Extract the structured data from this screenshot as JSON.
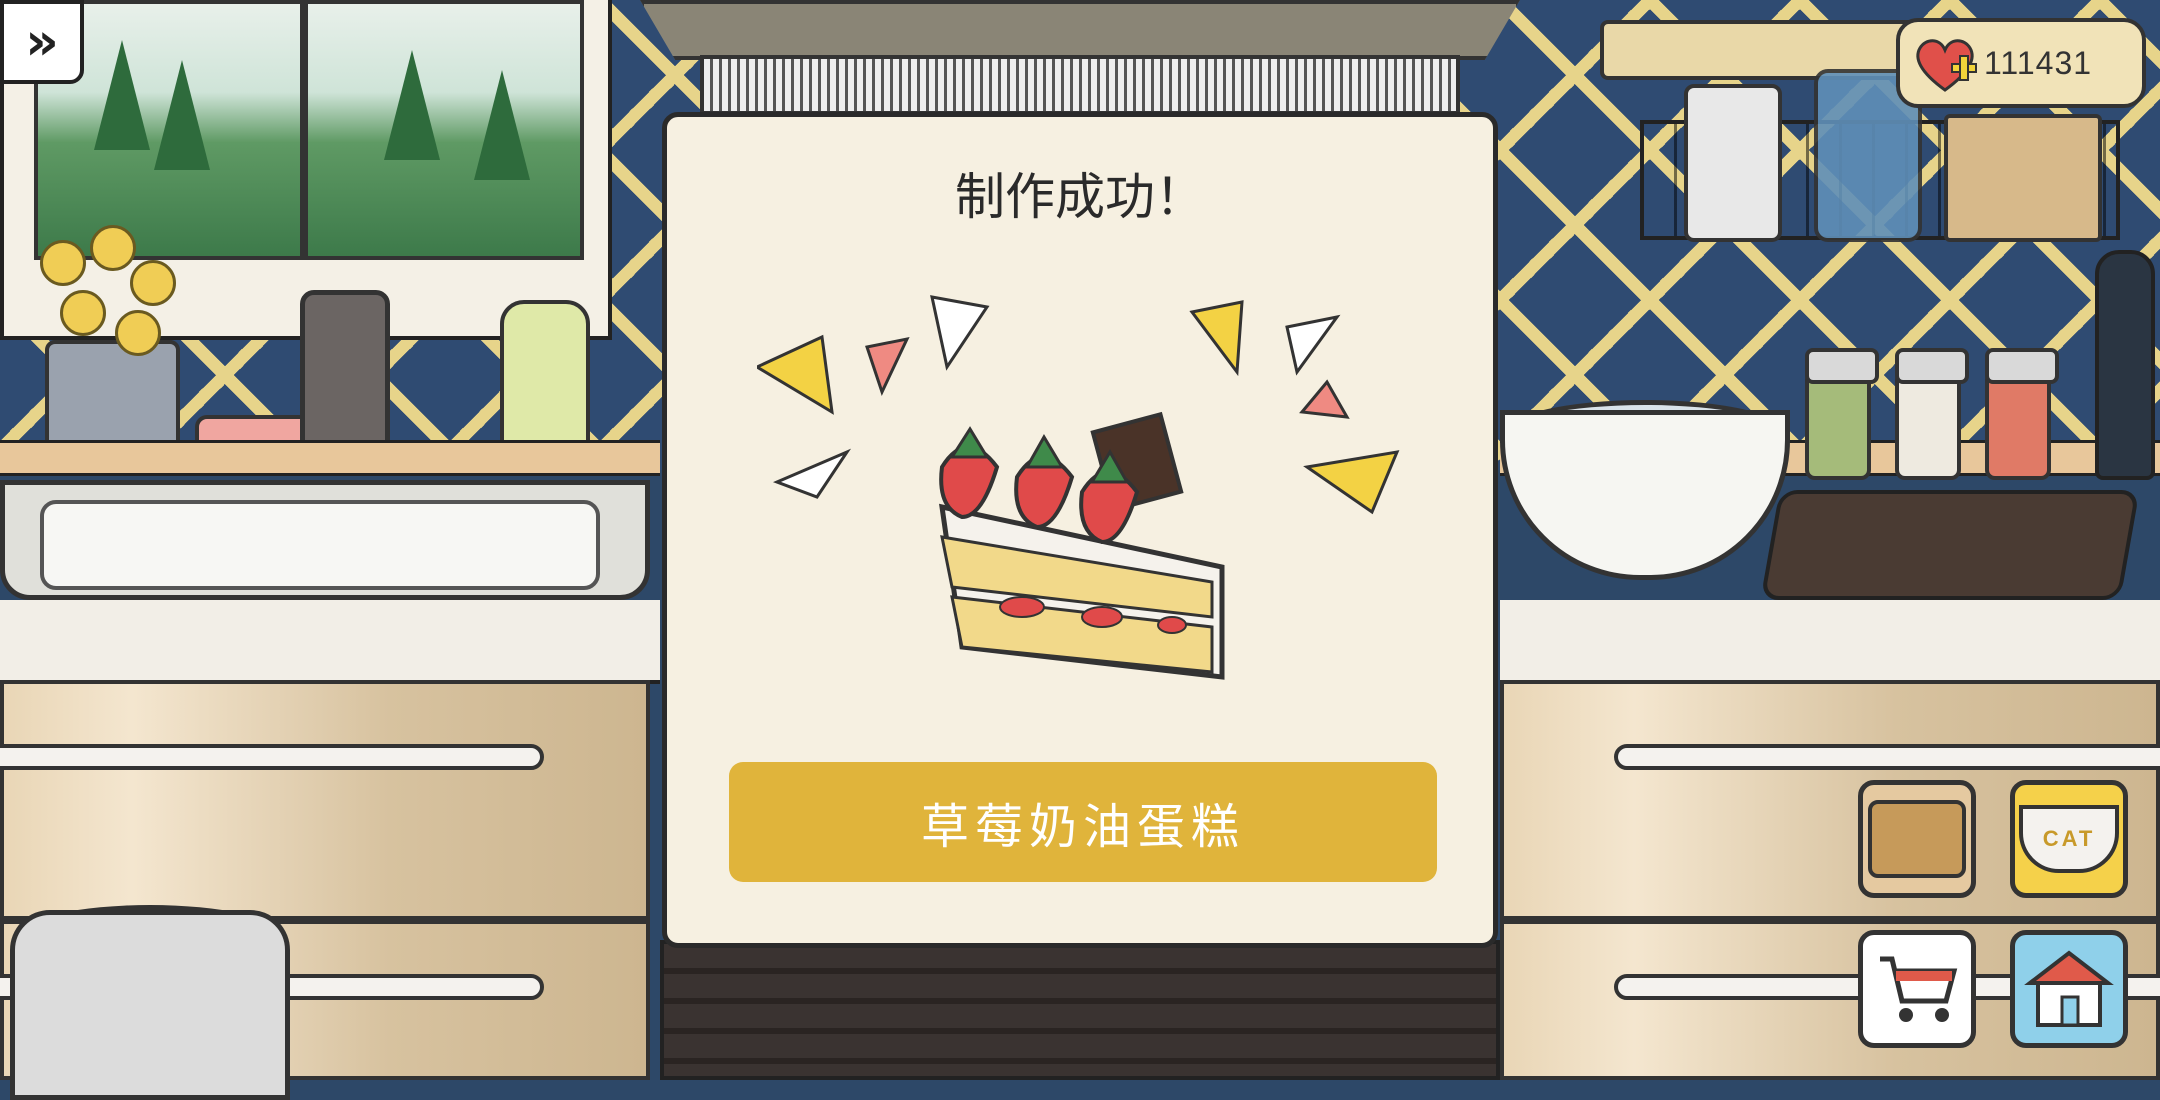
{
  "hud": {
    "currency_value": "111431",
    "cat_bowl_label": "CAT"
  },
  "dialog": {
    "title": "制作成功！",
    "dish_name": "草莓奶油蛋糕"
  },
  "colors": {
    "dialog_bg": "#f6f0e1",
    "button_gold": "#e0b43b",
    "wall_blue": "#2f4b72",
    "tile_line": "#e7d48a"
  },
  "icons": [
    "skip-forward-icon",
    "heart-plus-icon",
    "cat-bowl-icon",
    "shopping-cart-icon",
    "shop-house-icon",
    "cake-icon"
  ]
}
